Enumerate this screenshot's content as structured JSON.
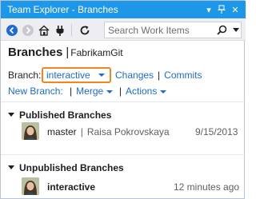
{
  "window": {
    "title": "Team Explorer - Branches",
    "pin_glyph": "↓",
    "dropdown_glyph": "▾",
    "close_glyph": "✕"
  },
  "toolbar": {
    "search": {
      "placeholder": "Search Work Items"
    },
    "icons": [
      "back-icon",
      "forward-icon",
      "home-icon",
      "plug-icon",
      "refresh-icon",
      "search-icon"
    ]
  },
  "header": {
    "title": "Branches",
    "separator": "|",
    "context": "FabrikamGit"
  },
  "branch_bar": {
    "label": "Branch:",
    "selected": "interactive",
    "changes": "Changes",
    "commits": "Commits",
    "pipe": "|"
  },
  "actions_bar": {
    "new_branch": "New Branch:",
    "merge": "Merge",
    "actions": "Actions",
    "pipe": "|"
  },
  "published": {
    "title": "Published Branches",
    "items": [
      {
        "name": "master",
        "separator": "|",
        "author": "Raisa Pokrovskaya",
        "date": "9/15/2013"
      }
    ]
  },
  "unpublished": {
    "title": "Unpublished Branches",
    "items": [
      {
        "name": "interactive",
        "time": "12 minutes ago"
      }
    ]
  },
  "colors": {
    "titlebar": "#1c97ea",
    "link": "#1e6bd6",
    "highlight": "#f0861d",
    "toolbar_bg": "#eeeef2"
  }
}
